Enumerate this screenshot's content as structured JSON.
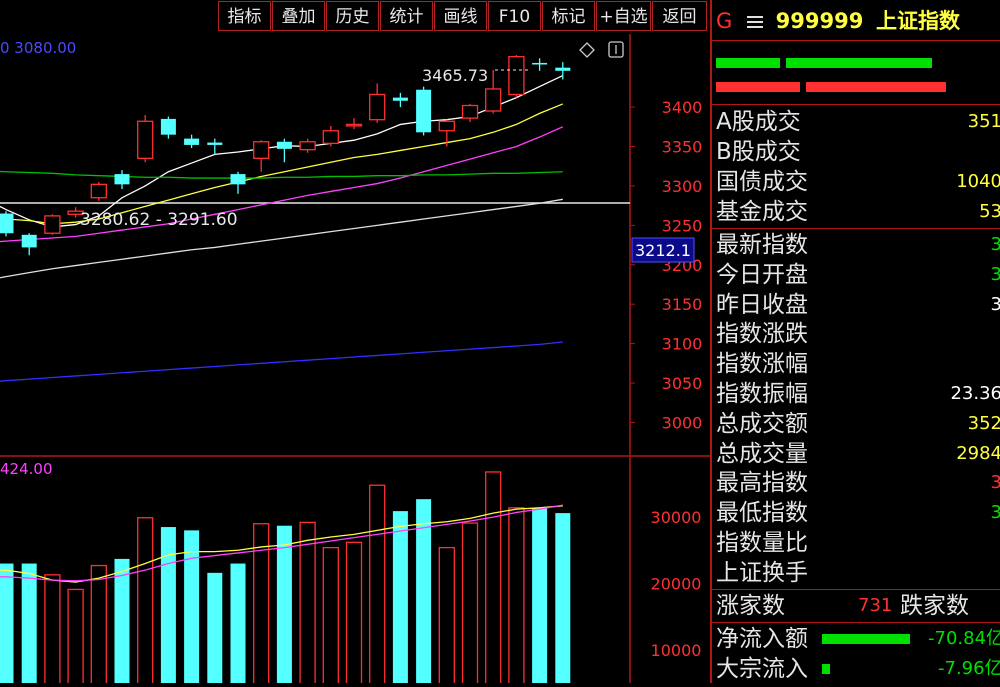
{
  "toolbar": {
    "buttons": [
      "指标",
      "叠加",
      "历史",
      "统计",
      "画线",
      "F10",
      "标记",
      "+自选",
      "返回"
    ]
  },
  "chart": {
    "top_left_value": "0  3080.00",
    "price_axis": [
      "3400",
      "3350",
      "3300",
      "3250",
      "3200",
      "3150",
      "3100",
      "3050",
      "3000"
    ],
    "current_price_tag": "3212.1",
    "high_annotation": "3465.73",
    "range_annotation": "3280.62 - 3291.60",
    "volume_label": "424.00",
    "volume_axis": [
      "30000",
      "20000",
      "10000"
    ],
    "colors": {
      "up": "#ff3030",
      "down": "#54ffff",
      "ma5": "#ffffff",
      "ma10": "#ffff40",
      "ma20": "#ff40ff",
      "ma60": "#00c000",
      "ma120": "#e0e0e0",
      "ma250": "#3030ff",
      "axis_text": "#ff3030",
      "frame": "#b01818"
    }
  },
  "panel": {
    "code_letter": "G",
    "menu_icon": "hamburger-icon",
    "code": "999999",
    "name": "上证指数",
    "rows_a": [
      {
        "label": "A股成交",
        "value": "351"
      },
      {
        "label": "B股成交",
        "value": ""
      },
      {
        "label": "国债成交",
        "value": "1040"
      },
      {
        "label": "基金成交",
        "value": "53"
      }
    ],
    "rows_b": [
      {
        "label": "最新指数",
        "value": "3",
        "color": "#00e000"
      },
      {
        "label": "今日开盘",
        "value": "3",
        "color": "#00e000"
      },
      {
        "label": "昨日收盘",
        "value": "3",
        "color": "#ffffff"
      },
      {
        "label": "指数涨跌",
        "value": "",
        "color": "#00e000"
      },
      {
        "label": "指数涨幅",
        "value": "",
        "color": "#00e000"
      },
      {
        "label": "指数振幅",
        "value": "23.36",
        "color": "#ffffff"
      },
      {
        "label": "总成交额",
        "value": "352",
        "color": "#ffff40"
      },
      {
        "label": "总成交量",
        "value": "2984",
        "color": "#ffff40"
      },
      {
        "label": "最高指数",
        "value": "3",
        "color": "#ff3030"
      },
      {
        "label": "最低指数",
        "value": "3",
        "color": "#00e000"
      },
      {
        "label": "指数量比",
        "value": "",
        "color": "#ffffff"
      },
      {
        "label": "上证换手",
        "value": "",
        "color": "#ffffff"
      }
    ],
    "rise_label": "涨家数",
    "rise_count": "731",
    "fall_label": "跌家数",
    "inflow_label": "净流入额",
    "inflow_value": "-70.84亿",
    "block_label": "大宗流入",
    "block_value": "-7.96亿"
  },
  "chart_data": {
    "type": "candlestick",
    "price_range": [
      2960,
      3480
    ],
    "candles": [
      {
        "o": 3265,
        "c": 3240,
        "h": 3268,
        "l": 3236
      },
      {
        "o": 3238,
        "c": 3222,
        "h": 3240,
        "l": 3212
      },
      {
        "o": 3240,
        "c": 3262,
        "h": 3264,
        "l": 3238
      },
      {
        "o": 3264,
        "c": 3268,
        "h": 3273,
        "l": 3260
      },
      {
        "o": 3285,
        "c": 3302,
        "h": 3305,
        "l": 3281
      },
      {
        "o": 3315,
        "c": 3302,
        "h": 3320,
        "l": 3296
      },
      {
        "o": 3335,
        "c": 3382,
        "h": 3390,
        "l": 3330
      },
      {
        "o": 3385,
        "c": 3365,
        "h": 3388,
        "l": 3360
      },
      {
        "o": 3360,
        "c": 3352,
        "h": 3365,
        "l": 3348
      },
      {
        "o": 3355,
        "c": 3352,
        "h": 3360,
        "l": 3340
      },
      {
        "o": 3315,
        "c": 3302,
        "h": 3318,
        "l": 3290
      },
      {
        "o": 3335,
        "c": 3356,
        "h": 3358,
        "l": 3318
      },
      {
        "o": 3356,
        "c": 3347,
        "h": 3360,
        "l": 3330
      },
      {
        "o": 3346,
        "c": 3356,
        "h": 3360,
        "l": 3342
      },
      {
        "o": 3354,
        "c": 3370,
        "h": 3376,
        "l": 3350
      },
      {
        "o": 3378,
        "c": 3378,
        "h": 3386,
        "l": 3372
      },
      {
        "o": 3384,
        "c": 3416,
        "h": 3430,
        "l": 3380
      },
      {
        "o": 3412,
        "c": 3408,
        "h": 3418,
        "l": 3400
      },
      {
        "o": 3422,
        "c": 3368,
        "h": 3426,
        "l": 3364
      },
      {
        "o": 3370,
        "c": 3382,
        "h": 3384,
        "l": 3350
      },
      {
        "o": 3386,
        "c": 3402,
        "h": 3404,
        "l": 3381
      },
      {
        "o": 3395,
        "c": 3423,
        "h": 3447,
        "l": 3392
      },
      {
        "o": 3416,
        "c": 3464,
        "h": 3466,
        "l": 3412
      },
      {
        "o": 3456,
        "c": 3454,
        "h": 3462,
        "l": 3446
      },
      {
        "o": 3450,
        "c": 3446,
        "h": 3457,
        "l": 3435
      }
    ],
    "ma_lines": [
      {
        "name": "MA5",
        "values": [
          3270,
          3257,
          3248,
          3251,
          3262,
          3285,
          3300,
          3318,
          3329,
          3340,
          3343,
          3347,
          3351,
          3350,
          3354,
          3358,
          3366,
          3378,
          3382,
          3384,
          3388,
          3400,
          3412,
          3426,
          3440
        ]
      },
      {
        "name": "MA10",
        "values": [
          3258,
          3256,
          3252,
          3254,
          3258,
          3266,
          3274,
          3282,
          3290,
          3298,
          3305,
          3312,
          3318,
          3324,
          3330,
          3336,
          3340,
          3345,
          3350,
          3355,
          3360,
          3368,
          3378,
          3392,
          3404
        ]
      },
      {
        "name": "MA20",
        "values": [
          3230,
          3232,
          3234,
          3236,
          3240,
          3244,
          3248,
          3252,
          3258,
          3264,
          3270,
          3276,
          3282,
          3288,
          3293,
          3298,
          3303,
          3310,
          3318,
          3326,
          3334,
          3342,
          3350,
          3362,
          3375
        ]
      },
      {
        "name": "MA60",
        "values": [
          3318,
          3317,
          3316,
          3314,
          3313,
          3312,
          3311,
          3311,
          3310,
          3310,
          3310,
          3310,
          3311,
          3311,
          3312,
          3312,
          3313,
          3313,
          3314,
          3314,
          3315,
          3316,
          3316,
          3317,
          3318
        ]
      },
      {
        "name": "MA120",
        "values": [
          3185,
          3190,
          3195,
          3199,
          3203,
          3207,
          3211,
          3215,
          3219,
          3222,
          3226,
          3230,
          3234,
          3238,
          3242,
          3246,
          3250,
          3254,
          3258,
          3262,
          3266,
          3270,
          3274,
          3278,
          3283
        ]
      },
      {
        "name": "MA250",
        "values": [
          3053,
          3055,
          3057,
          3059,
          3061,
          3063,
          3065,
          3067,
          3069,
          3071,
          3073,
          3075,
          3077,
          3079,
          3081,
          3083,
          3085,
          3087,
          3089,
          3091,
          3093,
          3095,
          3097,
          3099,
          3102
        ]
      }
    ],
    "volume_range": [
      5000,
      38000
    ],
    "volumes": [
      23000,
      23000,
      21300,
      19100,
      22700,
      23700,
      29900,
      28500,
      28000,
      21600,
      23000,
      29000,
      28700,
      29200,
      25400,
      26200,
      34800,
      30900,
      32700,
      25400,
      29100,
      36800,
      31400,
      31300,
      30600
    ],
    "vol_ma": [
      [
        22000,
        21500,
        20500,
        20200,
        20800,
        21800,
        23000,
        24300,
        24800,
        24800,
        25000,
        25500,
        25800,
        26500,
        27000,
        27400,
        28000,
        28600,
        29000,
        29300,
        29800,
        30600,
        31200,
        31400,
        31700
      ],
      [
        21000,
        20800,
        20500,
        20400,
        20600,
        21200,
        22000,
        23000,
        23800,
        24200,
        24600,
        25000,
        25400,
        25900,
        26400,
        26900,
        27400,
        27900,
        28400,
        28900,
        29400,
        30000,
        30700,
        31200,
        31800
      ]
    ]
  }
}
